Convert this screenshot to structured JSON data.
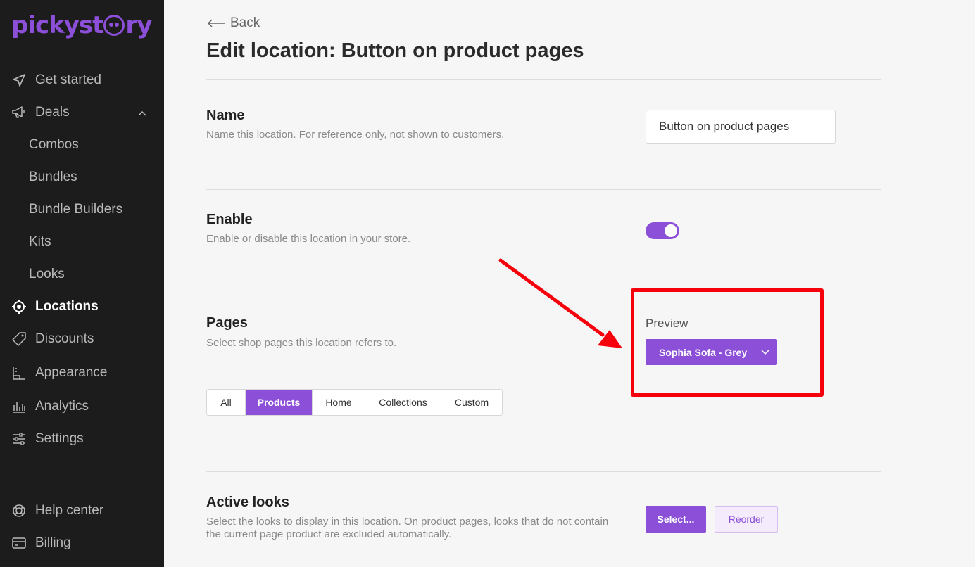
{
  "brand": {
    "logo_text_start": "pickyst",
    "logo_text_end": "ry",
    "accent": "#8b4fd8",
    "highlight": "#f5000b"
  },
  "sidebar": {
    "items": [
      {
        "label": "Get started",
        "icon": "send-icon"
      },
      {
        "label": "Deals",
        "icon": "megaphone-icon"
      },
      {
        "label": "Combos"
      },
      {
        "label": "Bundles"
      },
      {
        "label": "Bundle Builders"
      },
      {
        "label": "Kits"
      },
      {
        "label": "Looks"
      },
      {
        "label": "Locations",
        "icon": "target-icon",
        "active": true
      },
      {
        "label": "Discounts",
        "icon": "tag-icon"
      },
      {
        "label": "Appearance",
        "icon": "appearance-icon"
      },
      {
        "label": "Analytics",
        "icon": "bar-chart-icon"
      },
      {
        "label": "Settings",
        "icon": "sliders-icon"
      },
      {
        "label": "Help center",
        "icon": "lifebuoy-icon"
      },
      {
        "label": "Billing",
        "icon": "credit-card-icon"
      }
    ]
  },
  "header": {
    "back_label": "Back",
    "title": "Edit location: Button on product pages"
  },
  "sections": {
    "name": {
      "title": "Name",
      "description": "Name this location. For reference only, not shown to customers.",
      "value": "Button on product pages"
    },
    "enable": {
      "title": "Enable",
      "description": "Enable or disable this location in your store.",
      "enabled": true
    },
    "pages": {
      "title": "Pages",
      "description": "Select shop pages this location refers to.",
      "tabs": [
        "All",
        "Products",
        "Home",
        "Collections",
        "Custom"
      ],
      "active_tab": "Products",
      "preview_label": "Preview",
      "preview_value": "Sophia Sofa - Grey"
    },
    "active_looks": {
      "title": "Active looks",
      "description_line1": "Select the looks to display in this location. On product pages, looks that do not contain",
      "description_line2": "the current page product are excluded automatically.",
      "select_label": "Select...",
      "reorder_label": "Reorder"
    }
  }
}
